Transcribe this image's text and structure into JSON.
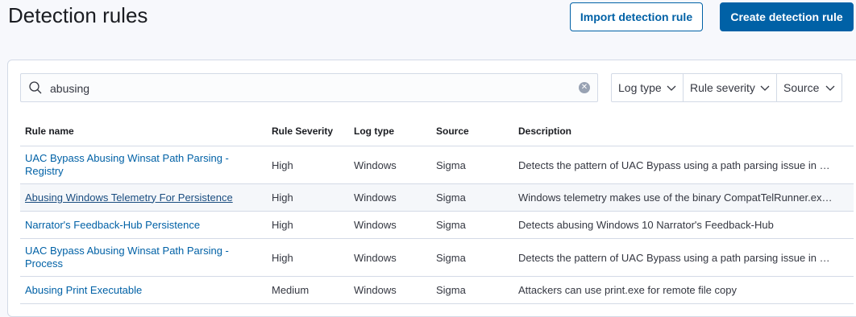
{
  "header": {
    "title": "Detection rules",
    "import_label": "Import detection rule",
    "create_label": "Create detection rule"
  },
  "search": {
    "value": "abusing",
    "placeholder": ""
  },
  "filters": {
    "log_type": "Log type",
    "rule_severity": "Rule severity",
    "source": "Source"
  },
  "table": {
    "columns": [
      "Rule name",
      "Rule Severity",
      "Log type",
      "Source",
      "Description"
    ],
    "rows": [
      {
        "name": "UAC Bypass Abusing Winsat Path Parsing - Registry",
        "severity": "High",
        "log_type": "Windows",
        "source": "Sigma",
        "description": "Detects the pattern of UAC Bypass using a path parsing issue in …"
      },
      {
        "name": "Abusing Windows Telemetry For Persistence",
        "severity": "High",
        "log_type": "Windows",
        "source": "Sigma",
        "description": "Windows telemetry makes use of the binary CompatTelRunner.ex…"
      },
      {
        "name": "Narrator's Feedback-Hub Persistence",
        "severity": "High",
        "log_type": "Windows",
        "source": "Sigma",
        "description": "Detects abusing Windows 10 Narrator's Feedback-Hub"
      },
      {
        "name": "UAC Bypass Abusing Winsat Path Parsing - Process",
        "severity": "High",
        "log_type": "Windows",
        "source": "Sigma",
        "description": "Detects the pattern of UAC Bypass using a path parsing issue in …"
      },
      {
        "name": "Abusing Print Executable",
        "severity": "Medium",
        "log_type": "Windows",
        "source": "Sigma",
        "description": "Attackers can use print.exe for remote file copy"
      }
    ]
  },
  "colors": {
    "primary": "#0061a6",
    "background": "#f7f8fc",
    "border": "#d3dae6"
  },
  "icons": {
    "search": "search-icon",
    "clear": "clear-icon",
    "chevron": "chevron-down-icon"
  }
}
